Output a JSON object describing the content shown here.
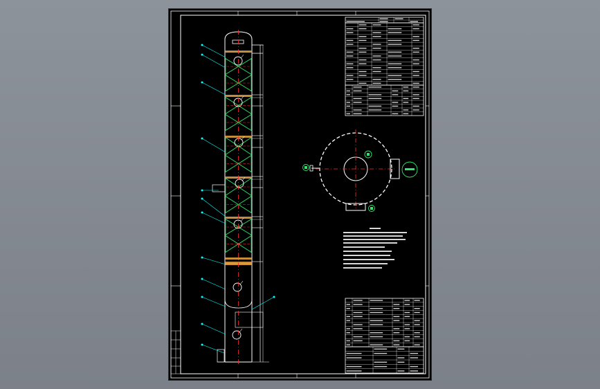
{
  "viewport": {
    "background": "#868b93"
  },
  "drawing": {
    "background": "#000000",
    "border_color": "#ffffff",
    "tower_color": "#ffffff",
    "centerline_color": "#ff2a2a",
    "packing_color": "#2ee66b",
    "platform_color": "#e8a443",
    "leader_color": "#00ffff",
    "section_marks": [
      "N1",
      "N2",
      "N3",
      "N4"
    ],
    "title_block": {
      "header_left": "",
      "header_right": ""
    }
  }
}
